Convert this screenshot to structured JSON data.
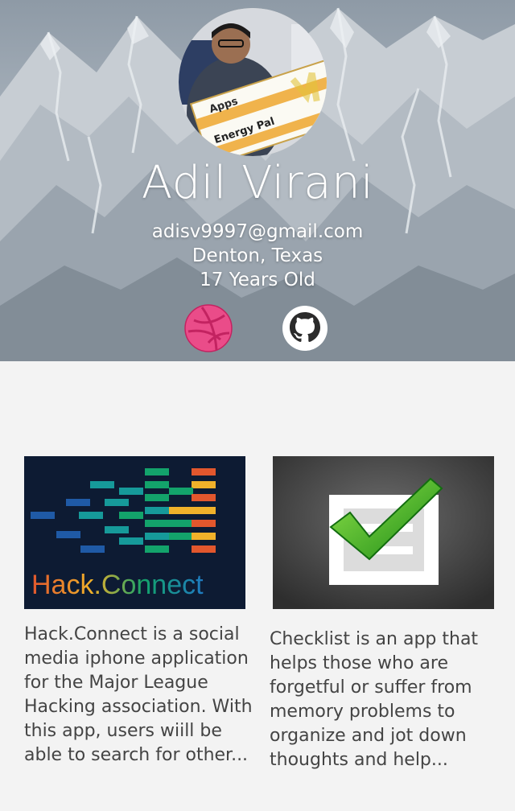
{
  "profile": {
    "name": "Adil Virani",
    "email": "adisv9997@gmail.com",
    "location": "Denton, Texas",
    "age": "17 Years Old",
    "avatar_check_text": "Energy Pal",
    "avatar_check_brand": "Apps"
  },
  "social": {
    "dribbble_icon": "dribbble-icon",
    "github_icon": "github-icon",
    "dribbble_color": "#ea4c89"
  },
  "projects": [
    {
      "thumb_label": "Hack.Connect",
      "description": "Hack.Connect is a social media iphone application for the Major League Hacking association. With this app, users wiill be able to search for other..."
    },
    {
      "thumb_icon": "checklist-icon",
      "description": "Checklist is an app that helps those who are forgetful or suffer from memory problems to organize and jot down thoughts and help..."
    }
  ]
}
